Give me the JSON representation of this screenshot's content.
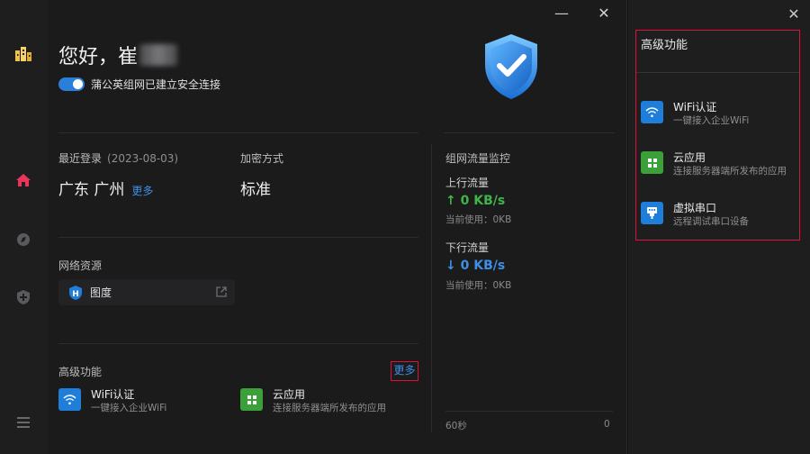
{
  "app": {
    "greeting": "您好，崔",
    "connection_status": "蒲公英组网已建立安全连接"
  },
  "window": {
    "minimize_label": "—",
    "close_label": "✕",
    "panel_close_label": "✕"
  },
  "sidebar": {
    "items": [
      {
        "icon": "building-logo-icon"
      },
      {
        "icon": "home-icon",
        "active": true
      },
      {
        "icon": "compass-icon"
      },
      {
        "icon": "shield-plus-icon"
      },
      {
        "icon": "menu-icon"
      }
    ]
  },
  "info": {
    "last_login_label": "最近登录",
    "last_login_date": "(2023-08-03)",
    "location": "广东 广州",
    "location_more": "更多",
    "encryption_label": "加密方式",
    "encryption_value": "标准"
  },
  "resources": {
    "title": "网络资源",
    "items": [
      {
        "name": "图度"
      }
    ]
  },
  "features": {
    "title": "高级功能",
    "more": "更多",
    "items": [
      {
        "title": "WiFi认证",
        "subtitle": "一键接入企业WiFi"
      },
      {
        "title": "云应用",
        "subtitle": "连接服务器端所发布的应用"
      }
    ]
  },
  "traffic": {
    "title": "组网流量监控",
    "upload": {
      "label": "上行流量",
      "value": "↑ 0 KB/s",
      "usage": "当前使用：0KB"
    },
    "download": {
      "label": "下行流量",
      "value": "↓ 0 KB/s",
      "usage": "当前使用：0KB"
    },
    "axis_left": "60秒",
    "axis_right": "0"
  },
  "panel": {
    "title": "高级功能",
    "items": [
      {
        "title": "WiFi认证",
        "subtitle": "一键接入企业WiFi"
      },
      {
        "title": "云应用",
        "subtitle": "连接服务器端所发布的应用"
      },
      {
        "title": "虚拟串口",
        "subtitle": "远程调试串口设备"
      }
    ]
  },
  "colors": {
    "accent_blue": "#1e7ed9",
    "link_blue": "#3d8fe6",
    "upload_green": "#3fb549",
    "app_green": "#3ca03a",
    "highlight_red": "#e0103c",
    "active_home": "#e8355a"
  }
}
